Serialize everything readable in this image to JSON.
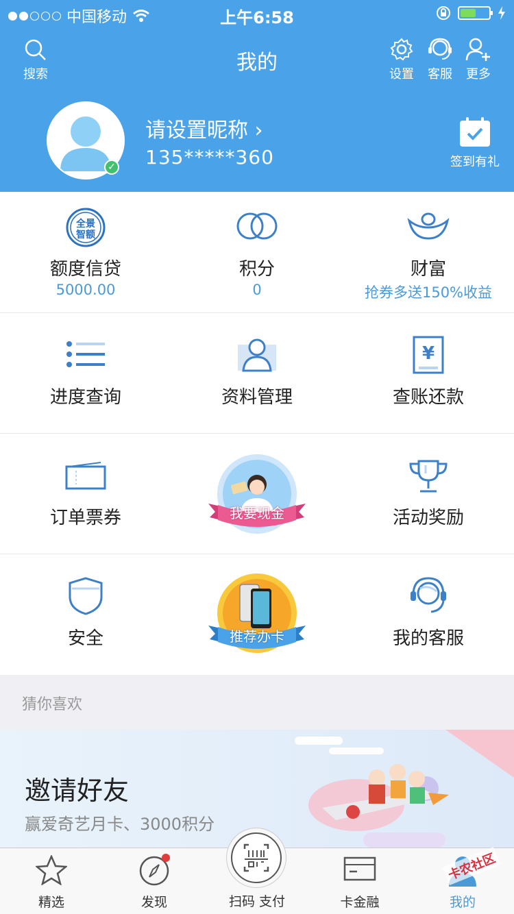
{
  "status_bar": {
    "carrier": "中国移动",
    "time": "上午6:58"
  },
  "header": {
    "title": "我的",
    "search_label": "搜索",
    "settings_label": "设置",
    "service_label": "客服",
    "more_label": "更多",
    "nickname": "请设置昵称",
    "nickname_arrow": "›",
    "phone": "135*****360",
    "checkin_label": "签到有礼"
  },
  "grid": {
    "row1": [
      {
        "label": "额度信贷",
        "sub": "5000.00",
        "icon": "quota-seal-icon",
        "icon_text": [
          "全景",
          "智额"
        ]
      },
      {
        "label": "积分",
        "sub": "0",
        "icon": "points-rings-icon"
      },
      {
        "label": "财富",
        "sub": "抢券多送150%收益",
        "icon": "wealth-ingot-icon"
      }
    ],
    "row2": [
      {
        "label": "进度查询",
        "icon": "list-icon"
      },
      {
        "label": "资料管理",
        "icon": "profile-card-icon"
      },
      {
        "label": "查账还款",
        "icon": "yuan-bill-icon",
        "icon_text": "¥"
      }
    ],
    "row3": [
      {
        "label": "订单票券",
        "icon": "ticket-icon"
      },
      {
        "label": "我要现金",
        "icon": "cash-badge-icon"
      },
      {
        "label": "活动奖励",
        "icon": "trophy-icon"
      }
    ],
    "row4": [
      {
        "label": "安全",
        "icon": "shield-icon"
      },
      {
        "label": "推荐办卡",
        "icon": "card-badge-icon"
      },
      {
        "label": "我的客服",
        "icon": "headset-icon"
      }
    ]
  },
  "guess": {
    "title": "猜你喜欢",
    "banner_title": "邀请好友",
    "banner_sub": "赢爱奇艺月卡、3000积分"
  },
  "tabbar": [
    {
      "label": "精选",
      "icon": "star-icon"
    },
    {
      "label": "发现",
      "icon": "compass-icon"
    },
    {
      "label": "扫码 支付",
      "icon": "scan-icon"
    },
    {
      "label": "卡金融",
      "icon": "card-icon"
    },
    {
      "label": "我的",
      "icon": "user-icon",
      "overlay": "卡农社区"
    }
  ],
  "colors": {
    "brand_blue": "#4aa3e8",
    "accent_text": "#4a9ad8",
    "badge_green": "#41c06d"
  }
}
